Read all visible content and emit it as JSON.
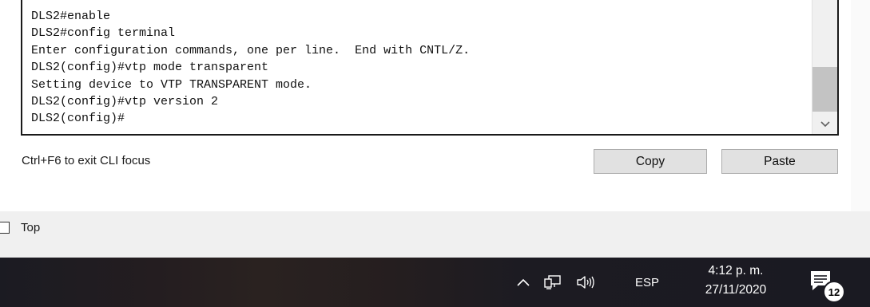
{
  "terminal": {
    "lines": [
      "DLS2#enable",
      "DLS2#config terminal",
      "Enter configuration commands, one per line.  End with CNTL/Z.",
      "DLS2(config)#vtp mode transparent",
      "Setting device to VTP TRANSPARENT mode.",
      "DLS2(config)#vtp version 2",
      "DLS2(config)#"
    ],
    "scrollbar_icon": "chevron-down-icon"
  },
  "cli": {
    "hint": "Ctrl+F6 to exit CLI focus",
    "copy_label": "Copy",
    "paste_label": "Paste"
  },
  "top_option": {
    "label": "Top",
    "checked": false
  },
  "taskbar": {
    "tray_icons": [
      "chevron-up-icon",
      "network-icon",
      "volume-icon"
    ],
    "language": "ESP",
    "time": "4:12 p. m.",
    "date": "27/11/2020",
    "notifications_icon": "notification-center-icon",
    "notifications_count": "12"
  }
}
